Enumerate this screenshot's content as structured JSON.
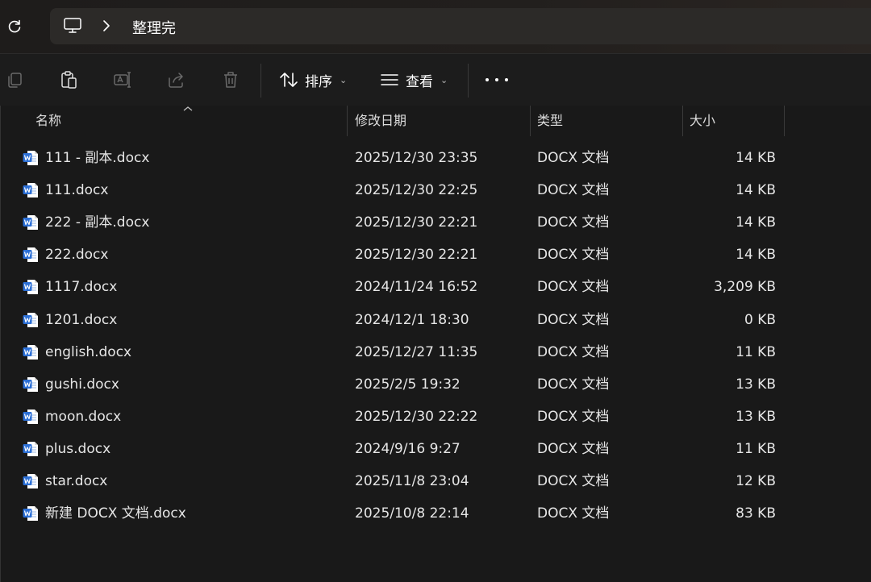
{
  "address": {
    "path_label": "整理完",
    "pc_icon": "monitor-icon",
    "separator_icon": "chevron-right-icon"
  },
  "toolbar": {
    "sort_label": "排序",
    "view_label": "查看",
    "icons": [
      "copy-icon",
      "paste-icon",
      "rename-icon",
      "share-icon",
      "delete-icon",
      "sort-icon",
      "view-icon",
      "more-icon"
    ]
  },
  "columns": {
    "name": "名称",
    "modified": "修改日期",
    "type": "类型",
    "size": "大小"
  },
  "files": [
    {
      "name": "111 - 副本.docx",
      "modified": "2025/12/30 23:35",
      "type": "DOCX 文档",
      "size": "14 KB"
    },
    {
      "name": "111.docx",
      "modified": "2025/12/30 22:25",
      "type": "DOCX 文档",
      "size": "14 KB"
    },
    {
      "name": "222 - 副本.docx",
      "modified": "2025/12/30 22:21",
      "type": "DOCX 文档",
      "size": "14 KB"
    },
    {
      "name": "222.docx",
      "modified": "2025/12/30 22:21",
      "type": "DOCX 文档",
      "size": "14 KB"
    },
    {
      "name": "1117.docx",
      "modified": "2024/11/24 16:52",
      "type": "DOCX 文档",
      "size": "3,209 KB"
    },
    {
      "name": "1201.docx",
      "modified": "2024/12/1 18:30",
      "type": "DOCX 文档",
      "size": "0 KB"
    },
    {
      "name": "english.docx",
      "modified": "2025/12/27 11:35",
      "type": "DOCX 文档",
      "size": "11 KB"
    },
    {
      "name": "gushi.docx",
      "modified": "2025/2/5 19:32",
      "type": "DOCX 文档",
      "size": "13 KB"
    },
    {
      "name": "moon.docx",
      "modified": "2025/12/30 22:22",
      "type": "DOCX 文档",
      "size": "13 KB"
    },
    {
      "name": "plus.docx",
      "modified": "2024/9/16 9:27",
      "type": "DOCX 文档",
      "size": "11 KB"
    },
    {
      "name": "star.docx",
      "modified": "2025/11/8 23:04",
      "type": "DOCX 文档",
      "size": "12 KB"
    },
    {
      "name": "新建 DOCX 文档.docx",
      "modified": "2025/10/8 22:14",
      "type": "DOCX 文档",
      "size": "83 KB"
    }
  ],
  "colors": {
    "background": "#191919",
    "word_blue": "#2b6fd6",
    "text": "#e6e6e6"
  }
}
